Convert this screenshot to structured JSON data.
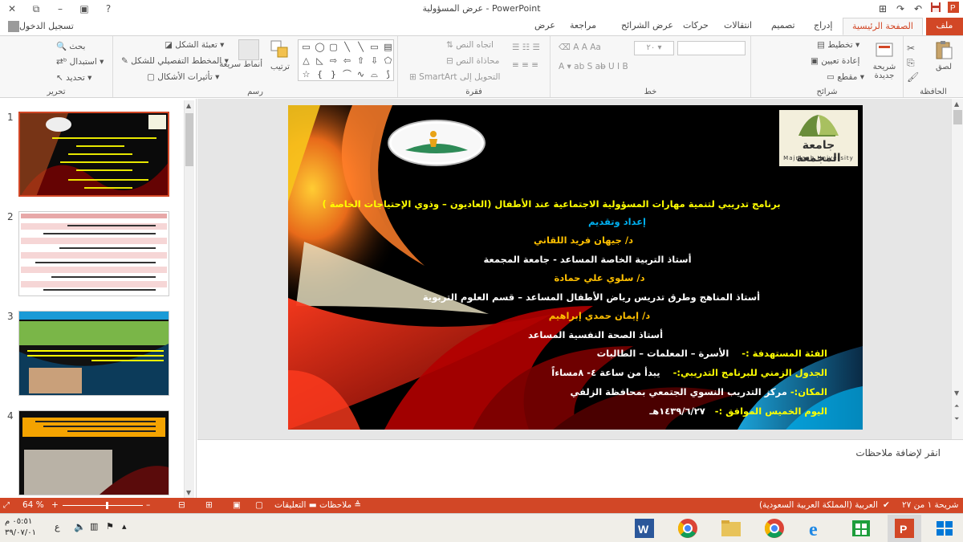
{
  "window": {
    "title": "عرض المسؤولية - PowerPoint",
    "help": "?",
    "minimize": "–",
    "restore": "⧉",
    "close": "✕",
    "qat": [
      "💾",
      "↶",
      "↷",
      "⊞"
    ]
  },
  "tabs": {
    "file": "ملف",
    "items": [
      "الصفحة الرئيسية",
      "إدراج",
      "تصميم",
      "انتقالات",
      "حركات",
      "عرض الشرائح",
      "مراجعة",
      "عرض"
    ],
    "active": "الصفحة الرئيسية",
    "signin": "تسجيل الدخول"
  },
  "ribbon": {
    "clipboard": {
      "label": "الحافظة",
      "paste": "لصق"
    },
    "slides": {
      "label": "شرائح",
      "new_slide": "شريحة جديدة",
      "layout": "تخطيط",
      "reset": "إعادة تعيين",
      "section": "مقطع"
    },
    "font": {
      "label": "خط",
      "size": "٢٠"
    },
    "paragraph": {
      "label": "فقرة",
      "text_direction": "اتجاه النص",
      "align_text": "محاذاة النص",
      "smartart": "التحويل إلى SmartArt"
    },
    "drawing": {
      "label": "رسم",
      "arrange": "ترتيب",
      "quick_styles": "أنماط سريعة",
      "fill": "تعبئة الشكل",
      "outline": "المخطط التفصيلي للشكل",
      "effects": "تأثيرات الأشكال"
    },
    "editing": {
      "label": "تحرير",
      "find": "بحث",
      "replace": "استبدال",
      "select": "تحديد"
    }
  },
  "thumbnails": [
    {
      "num": "1",
      "selected": true
    },
    {
      "num": "2",
      "selected": false
    },
    {
      "num": "3",
      "selected": false
    },
    {
      "num": "4",
      "selected": false
    }
  ],
  "slide": {
    "logo_text": "جامعة المجمعة",
    "logo_sub": "Majmaah University",
    "title": "برنامج تدريبي لتنمية مهارات المسؤولية الاجتماعية عند الأطفال (العاديون – وذوي الإحتياجات الخاصة )",
    "prepared": "إعداد وتقديم",
    "name1": "د/ جيهان فريد اللقاني",
    "role1": "أستاذ التربية الخاصة المساعد  - جامعة المجمعة",
    "name2": "د/ سلوي علي حمادة",
    "role2": "أستاذ المناهج وطرق تدريس رياض الأطفال المساعد – قسم العلوم التربوية",
    "name3": "د/ إيمان حمدي إبراهيم",
    "role3": "أستاذ الصحة النفسية المساعد",
    "target_label": "الفئة المستهدفة :-",
    "target_value": "الأسرة – المعلمات – الطالبات",
    "schedule_label": "الجدول الزمني للبرنامج التدريبي:-",
    "schedule_value": "يبدأ من ساعة ٤- ٨مساءاً",
    "place_label": "المكان:-",
    "place_value": "مركز التدريب النسوي الجتمعي بمحافظة الزلفي",
    "day_label": "اليوم الخميس الموافق :-",
    "day_value": "١٤٣٩/٦/٢٧هـ"
  },
  "notes": {
    "placeholder": "انقر لإضافة ملاحظات"
  },
  "status": {
    "slide_count": "شريحة ١ من ٢٧",
    "language": "العربية (المملكة العربية السعودية)",
    "notes": "ملاحظات",
    "comments": "التعليقات",
    "zoom": "64 %"
  },
  "taskbar": {
    "time": "٠٥:٥١ م",
    "date": "٣٩/٠٧/٠١",
    "lang": "ع"
  },
  "colors": {
    "accent": "#d24726",
    "yellow": "#ffff00",
    "cyan": "#00b0f0",
    "orange": "#ffc000"
  }
}
